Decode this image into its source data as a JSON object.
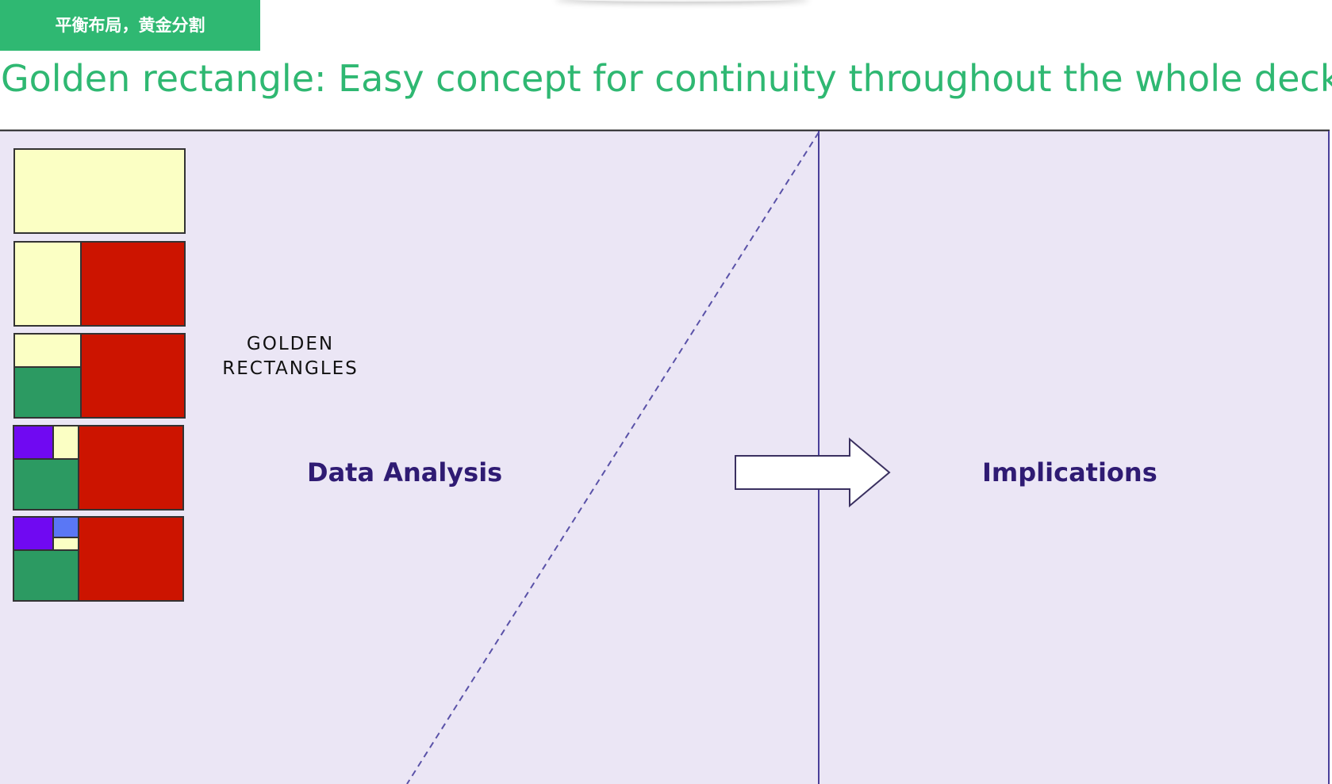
{
  "header": {
    "tag_label": "平衡布局，黄金分割",
    "title": "Golden rectangle: Easy concept for continuity throughout the whole deck"
  },
  "slide": {
    "golden_label_line1": "GOLDEN",
    "golden_label_line2": "RECTANGLES",
    "left_section_label": "Data Analysis",
    "right_section_label": "Implications"
  },
  "colors": {
    "accent_green": "#2fb872",
    "panel_background": "#ebe6f5",
    "rect_yellow": "#fbffc4",
    "rect_red": "#cc1400",
    "rect_green": "#2c9a62",
    "rect_purple": "#7009f2",
    "rect_blue": "#5a77f5",
    "section_text": "#2f1b73"
  },
  "icons": [
    "golden-rectangle-diagram",
    "right-arrow-icon"
  ]
}
